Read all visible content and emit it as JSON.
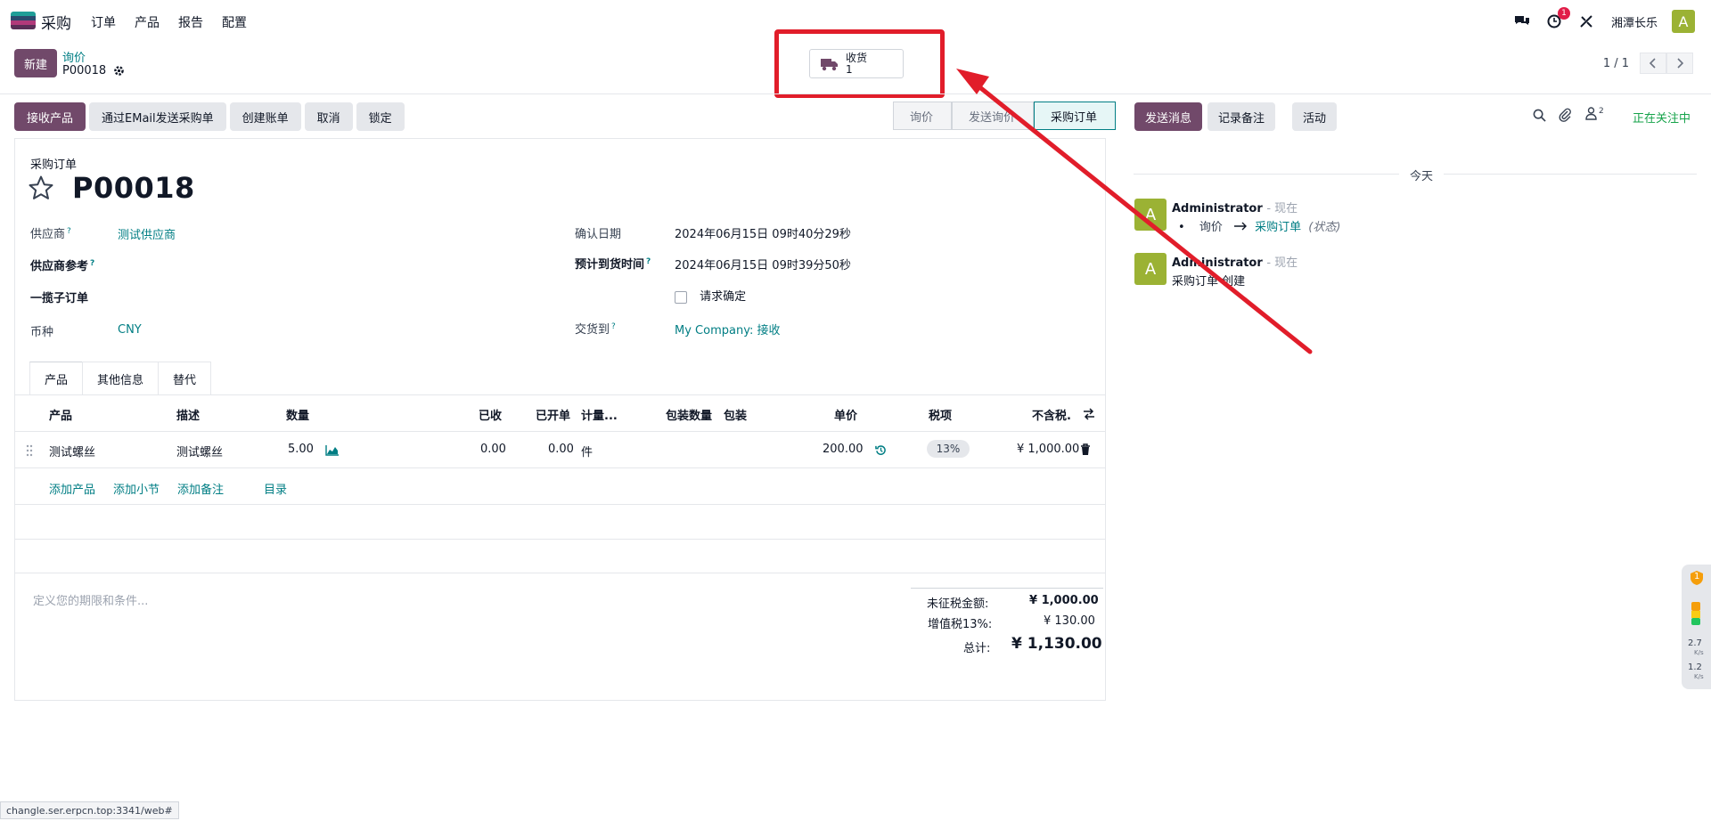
{
  "navbar": {
    "app_name": "采购",
    "menu": [
      "订单",
      "产品",
      "报告",
      "配置"
    ],
    "activity_count": "1",
    "company": "湘潭长乐",
    "user_initial": "A"
  },
  "control": {
    "new_label": "新建",
    "breadcrumb_parent": "询价",
    "breadcrumb_current": "P00018",
    "smart_button": {
      "label": "收货",
      "count": "1"
    },
    "pager": "1 / 1"
  },
  "actions": [
    "接收产品",
    "通过EMail发送采购单",
    "创建账单",
    "取消",
    "锁定"
  ],
  "stages": [
    "询价",
    "发送询价",
    "采购订单"
  ],
  "form": {
    "doc_type": "采购订单",
    "title": "P00018",
    "vendor_label": "供应商",
    "vendor_value": "测试供应商",
    "vendor_ref_label": "供应商参考",
    "blanket_label": "一揽子订单",
    "currency_label": "币种",
    "currency_value": "CNY",
    "confirm_date_label": "确认日期",
    "confirm_date_value": "2024年06月15日 09时40分29秒",
    "expected_label": "预计到货时间",
    "expected_value": "2024年06月15日 09时39分50秒",
    "ask_confirm_label": "请求确定",
    "deliver_to_label": "交货到",
    "deliver_to_value": "My Company: 接收",
    "help_mark": "?"
  },
  "tabs": [
    "产品",
    "其他信息",
    "替代"
  ],
  "table": {
    "headers": [
      "产品",
      "描述",
      "数量",
      "已收",
      "已开单",
      "计量...",
      "包装数量",
      "包装",
      "单价",
      "税项",
      "不含税."
    ],
    "row": {
      "product": "测试螺丝",
      "description": "测试螺丝",
      "qty": "5.00",
      "received": "0.00",
      "billed": "0.00",
      "uom": "件",
      "price": "200.00",
      "tax": "13%",
      "subtotal": "¥ 1,000.00"
    },
    "add_links": [
      "添加产品",
      "添加小节",
      "添加备注",
      "目录"
    ]
  },
  "terms_placeholder": "定义您的期限和条件...",
  "totals": {
    "untaxed_label": "未征税金额:",
    "untaxed_value": "¥ 1,000.00",
    "tax_label": "增值税13%:",
    "tax_value": "¥ 130.00",
    "total_label": "总计:",
    "total_value": "¥ 1,130.00"
  },
  "chatter": {
    "send_message": "发送消息",
    "log_note": "记录备注",
    "activity": "活动",
    "followers_count": "2",
    "following": "正在关注中",
    "today": "今天",
    "messages": [
      {
        "initial": "A",
        "author": "Administrator",
        "time": "- 现在",
        "from": "询价",
        "to": "采购订单",
        "field": "(状态)"
      },
      {
        "initial": "A",
        "author": "Administrator",
        "time": "- 现在",
        "body": "采购订单 创建"
      }
    ]
  },
  "widget": {
    "badge": "1",
    "up": "2.7",
    "down": "1.2",
    "unit": "K/s"
  },
  "status_url": "changle.ser.erpcn.top:3341/web#",
  "colors": {
    "brand": "#71496a",
    "link": "#017e84",
    "highlight": "#e11d2a",
    "avatar": "#9bb234"
  }
}
